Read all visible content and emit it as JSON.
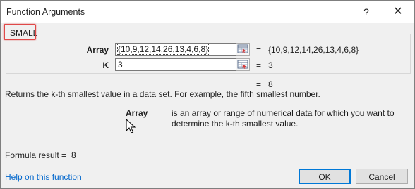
{
  "window": {
    "title": "Function Arguments",
    "help_glyph": "?",
    "close_glyph": "✕"
  },
  "function": {
    "name": "SMALL",
    "highlight_color": "#e04848"
  },
  "arguments": [
    {
      "label": "Array",
      "input_value": "{10,9,12,14,26,13,4,6,8}",
      "equals": "=",
      "evaluated": "{10,9,12,14,26,13,4,6,8}"
    },
    {
      "label": "K",
      "input_value": "3",
      "equals": "=",
      "evaluated": "3"
    }
  ],
  "result_preview": {
    "equals": "=",
    "value": "8"
  },
  "description": "Returns the k-th smallest value in a data set. For example, the fifth smallest number.",
  "argument_help": {
    "name": "Array",
    "text": "is an array or range of numerical data for which you want to determine the k-th smallest value."
  },
  "formula_result": {
    "label": "Formula result =",
    "value": "8"
  },
  "footer": {
    "help_link": "Help on this function",
    "ok_label": "OK",
    "cancel_label": "Cancel",
    "accent_color": "#0078d7",
    "link_color": "#0066cc"
  }
}
